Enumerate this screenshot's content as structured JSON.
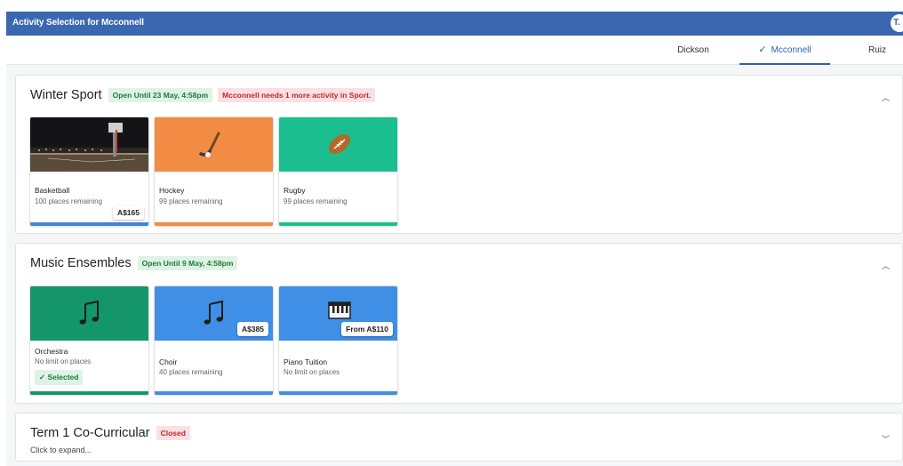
{
  "header": {
    "title": "Activity Selection for Mcconnell",
    "avatar_initial": "T."
  },
  "tabs": [
    {
      "label": "Dickson",
      "active": false
    },
    {
      "label": "Mcconnell",
      "active": true
    },
    {
      "label": "Ruiz",
      "active": false
    }
  ],
  "sections": [
    {
      "title": "Winter Sport",
      "badges": [
        "Open Until 23 May, 4:58pm",
        "Mcconnell needs 1 more activity in Sport."
      ],
      "expanded": true,
      "cards": [
        {
          "name": "Basketball",
          "sub": "100 places remaining",
          "price": "A$165",
          "icon": "basketball-court-photo",
          "color": "#3f86d6"
        },
        {
          "name": "Hockey",
          "sub": "99 places remaining",
          "icon": "hockey-stick-icon",
          "color": "#f28c45"
        },
        {
          "name": "Rugby",
          "sub": "99 places remaining",
          "icon": "rugby-ball-icon",
          "color": "#1bbf8f"
        }
      ]
    },
    {
      "title": "Music Ensembles",
      "badges": [
        "Open Until 9 May, 4:58pm"
      ],
      "expanded": true,
      "cards": [
        {
          "name": "Orchestra",
          "sub": "No limit on places",
          "selected_label": "Selected",
          "icon": "music-note-icon",
          "color": "#14956a"
        },
        {
          "name": "Choir",
          "sub": "40 places remaining",
          "price": "A$385",
          "icon": "music-note-icon",
          "color": "#3f8fe6"
        },
        {
          "name": "Piano Tuition",
          "sub": "No limit on places",
          "price": "From A$110",
          "icon": "piano-icon",
          "color": "#3f8fe6"
        }
      ]
    },
    {
      "title": "Term 1 Co-Curricular",
      "badges": [
        "Closed"
      ],
      "expanded": false,
      "expand_hint": "Click to expand..."
    }
  ]
}
